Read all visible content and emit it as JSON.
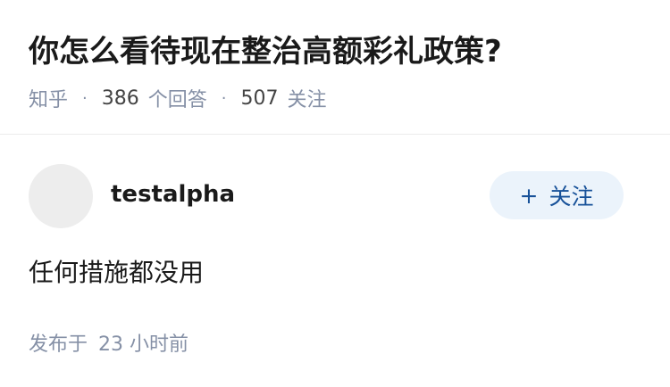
{
  "question": {
    "title": "你怎么看待现在整治高额彩礼政策?",
    "source": "知乎",
    "separator": "·",
    "answer_count": "386",
    "answer_label": "个回答",
    "follower_count": "507",
    "follower_label": "关注"
  },
  "answer": {
    "author_name": "testalpha",
    "follow_button": {
      "icon": "plus-icon",
      "icon_glyph": "+",
      "label": "关注"
    },
    "content": "任何措施都没用",
    "time_prefix": "发布于",
    "time_value": "23 小时前"
  },
  "colors": {
    "title": "#1a1a1a",
    "meta": "#8590a6",
    "follow_button_bg": "#ebf3fb",
    "follow_button_text": "#175199",
    "avatar": "#ededed",
    "divider": "#ebebeb"
  }
}
